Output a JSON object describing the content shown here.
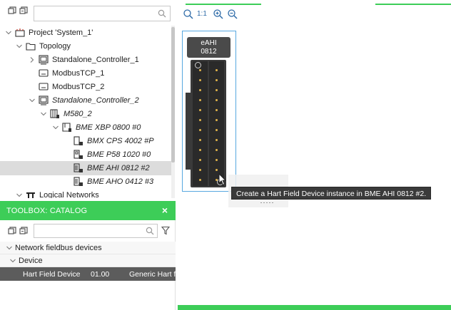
{
  "tree_panel": {
    "search": {
      "placeholder": "",
      "value": ""
    },
    "items": [
      {
        "label": "Project 'System_1'",
        "icon": "project-icon"
      },
      {
        "label": "Topology",
        "icon": "folder-icon"
      },
      {
        "label": "Standalone_Controller_1",
        "icon": "controller-icon"
      },
      {
        "label": "ModbusTCP_1",
        "icon": "network-icon"
      },
      {
        "label": "ModbusTCP_2",
        "icon": "network-icon"
      },
      {
        "label": "Standalone_Controller_2",
        "icon": "controller-icon"
      },
      {
        "label": "M580_2",
        "icon": "plc-icon"
      },
      {
        "label": "BME XBP 0800 #0",
        "icon": "rack-icon"
      },
      {
        "label": "BMX CPS 4002 #P",
        "icon": "power-module-icon"
      },
      {
        "label": "BME P58 1020 #0",
        "icon": "cpu-module-icon"
      },
      {
        "label": "BME AHI 0812 #2",
        "icon": "io-module-icon"
      },
      {
        "label": "BME AHO 0412 #3",
        "icon": "io-module-icon"
      },
      {
        "label": "Logical Networks",
        "icon": "logical-networks-icon"
      }
    ]
  },
  "toolbox": {
    "title": "TOOLBOX: CATALOG",
    "close": "×",
    "search": {
      "placeholder": "",
      "value": ""
    },
    "categories": [
      {
        "label": "Network fieldbus devices"
      },
      {
        "label": "Device"
      }
    ],
    "selected_item": {
      "name": "Hart Field Device",
      "version": "01.00",
      "description": "Generic Hart fi"
    }
  },
  "editor": {
    "zoom_one_to_one": "1:1",
    "module": {
      "line1": "eAHI",
      "line2": "0812"
    },
    "tooltip": "Create a Hart Field Device instance in BME AHI 0812 #2."
  },
  "colors": {
    "accent_green": "#3dcd58",
    "selection_blue": "#57a8e0",
    "module_dark": "#3a3a3a",
    "terminal_dot": "#e3b54a"
  }
}
